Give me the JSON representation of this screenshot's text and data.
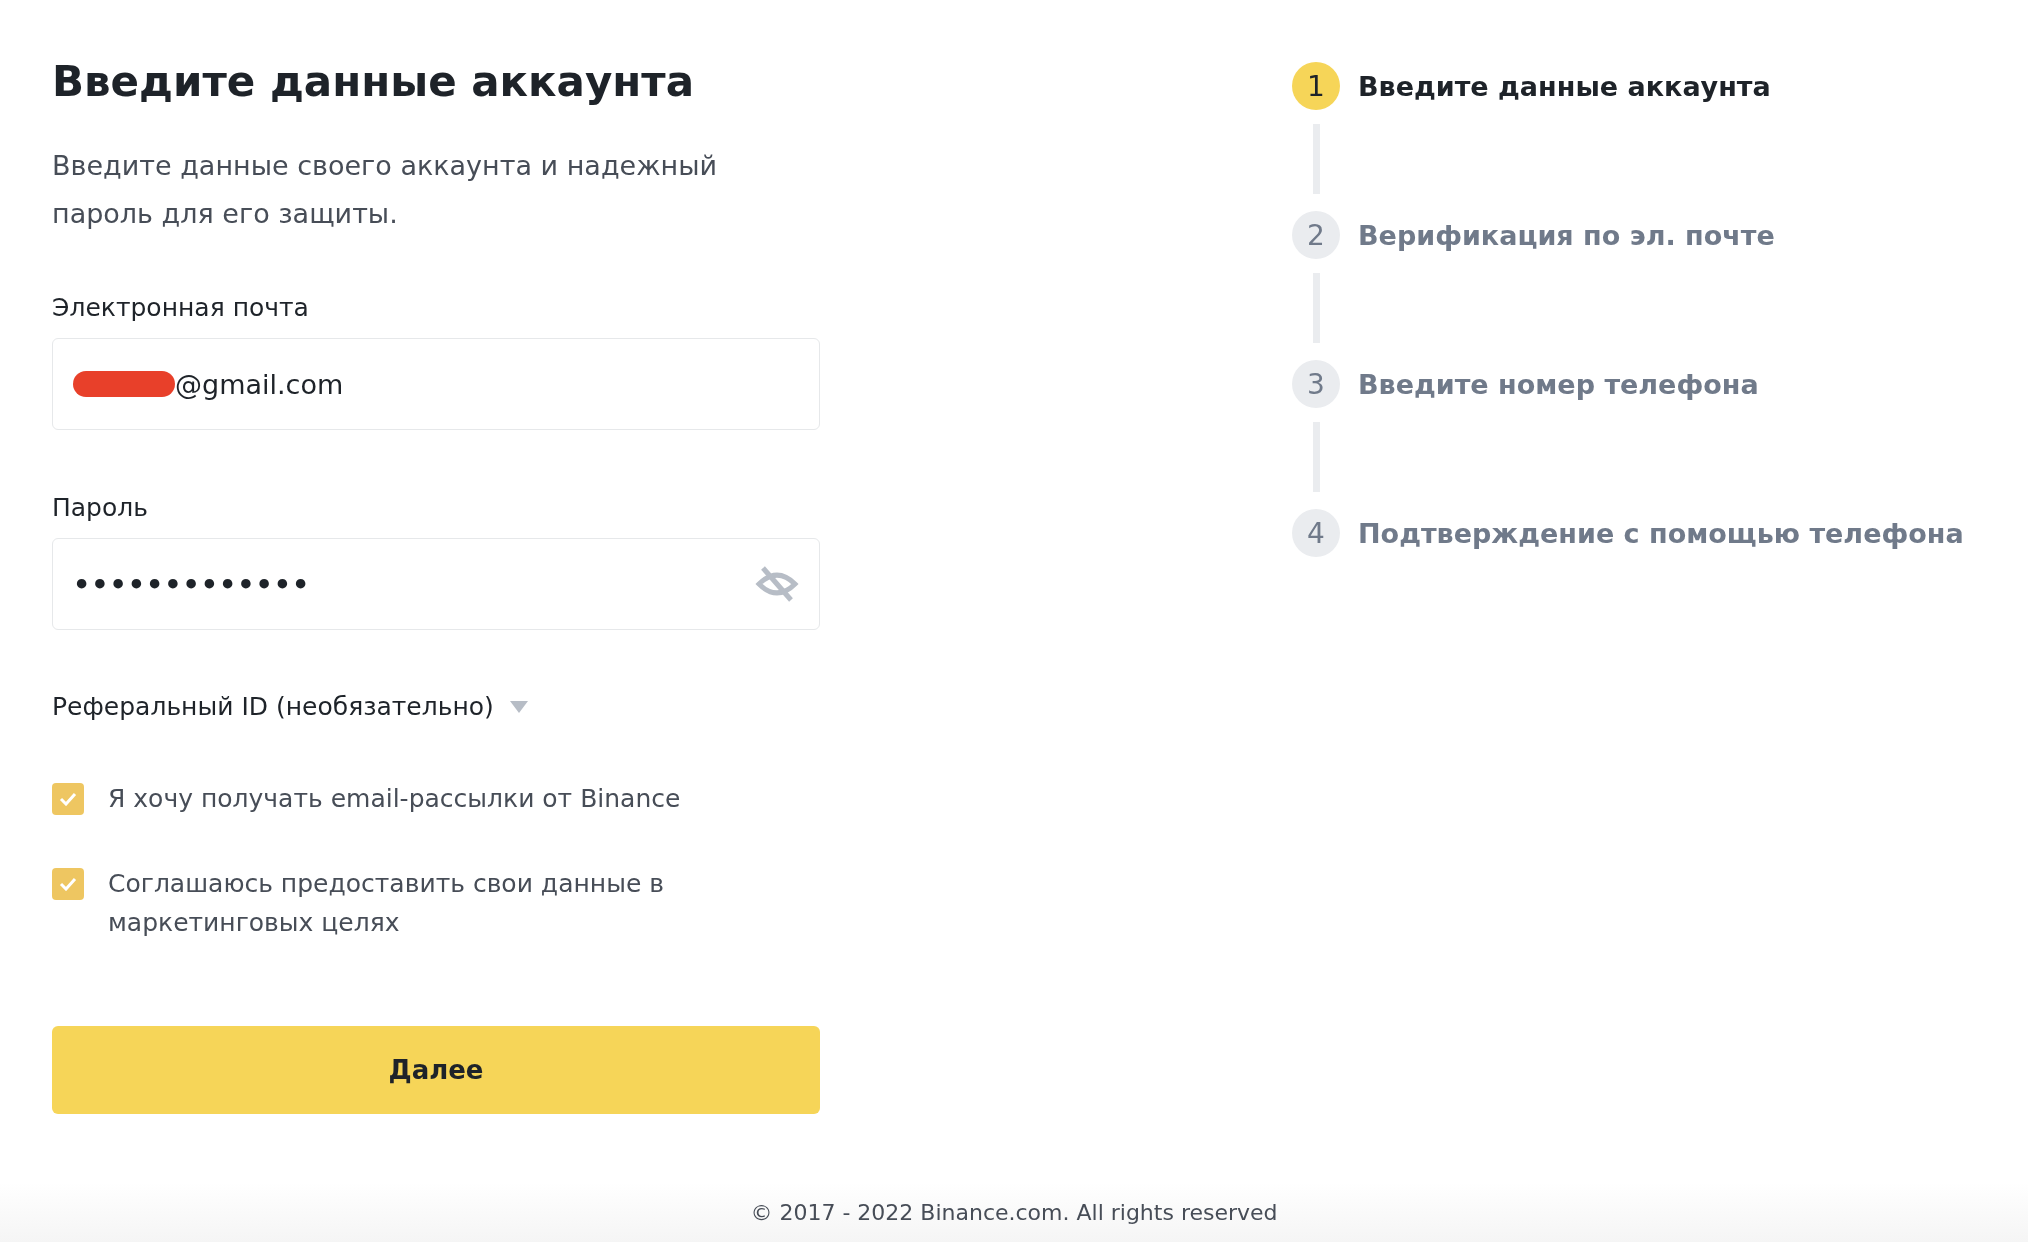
{
  "form": {
    "title": "Введите данные аккаунта",
    "description": "Введите данные своего аккаунта и надежный пароль для его защиты.",
    "email": {
      "label": "Электронная почта",
      "redacted": true,
      "value": "@gmail.com"
    },
    "password": {
      "label": "Пароль",
      "value": "•••••••••••••"
    },
    "referral": {
      "label": "Реферальный ID (необязательно)",
      "expanded": false
    },
    "checkboxes": [
      {
        "label": "Я хочу получать email-рассылки от Binance",
        "checked": true
      },
      {
        "label": "Соглашаюсь предоставить свои данные в маркетинговых целях",
        "checked": true
      }
    ],
    "submit": "Далее"
  },
  "steps": [
    {
      "number": "1",
      "label": "Введите данные аккаунта",
      "selected": true
    },
    {
      "number": "2",
      "label": "Верификация по эл. почте",
      "selected": false
    },
    {
      "number": "3",
      "label": "Введите номер телефона",
      "selected": false
    },
    {
      "number": "4",
      "label": "Подтверждение с помощью телефона",
      "selected": false
    }
  ],
  "footer": "© 2017 - 2022 Binance.com. All rights reserved"
}
